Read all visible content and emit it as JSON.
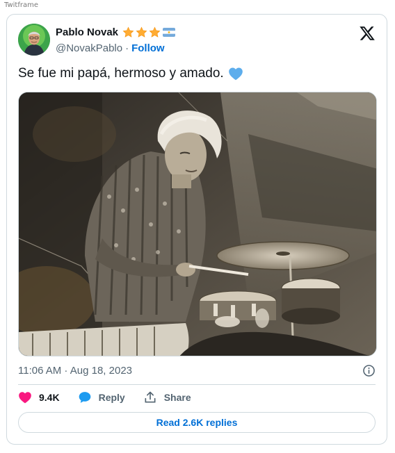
{
  "frame": {
    "label": "Twitframe"
  },
  "author": {
    "name": "Pablo Novak",
    "handle": "@NovakPablo",
    "separator": "·",
    "follow_label": "Follow",
    "badges": [
      "star-icon",
      "star-icon",
      "star-icon",
      "argentina-flag-icon"
    ]
  },
  "tweet": {
    "text": "Se fue mi papá, hermoso y amado.",
    "emoji": "blue-heart-icon",
    "timestamp": "11:06 AM · Aug 18, 2023"
  },
  "actions": {
    "likes": "9.4K",
    "reply_label": "Reply",
    "share_label": "Share"
  },
  "replies_button": {
    "label": "Read 2.6K replies"
  },
  "colors": {
    "link_blue": "#006fd6",
    "like_pink": "#f91880",
    "reply_blue": "#1d9bf0",
    "muted_text": "#536471",
    "border": "#cfd9de",
    "star_gold": "#ffac33",
    "heart_light_blue": "#5dadec"
  }
}
